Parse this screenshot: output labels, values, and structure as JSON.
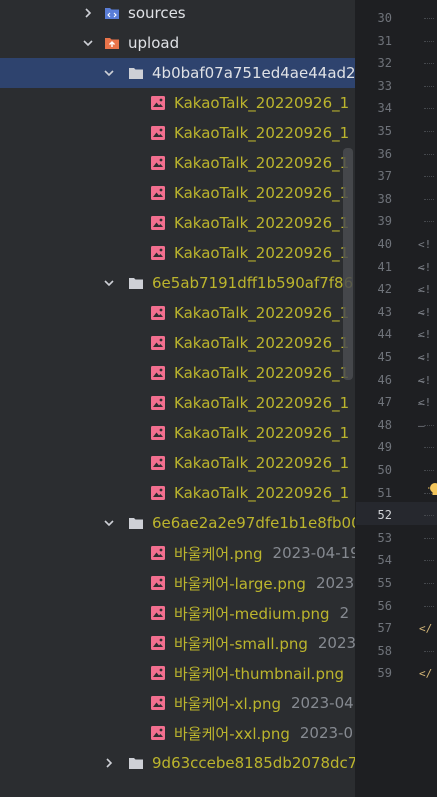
{
  "project_tree": {
    "rows": [
      {
        "kind": "folder-collapsed",
        "label": "sources",
        "style": "plain"
      },
      {
        "kind": "folder-expanded",
        "label": "upload",
        "style": "plain",
        "icon": "upload-folder"
      },
      {
        "kind": "folder-expanded",
        "label": "4b0baf07a751ed4ae44ad2",
        "style": "plain",
        "selected": true
      },
      {
        "kind": "file",
        "label": "KakaoTalk_20220926_1"
      },
      {
        "kind": "file",
        "label": "KakaoTalk_20220926_1"
      },
      {
        "kind": "file",
        "label": "KakaoTalk_20220926_1"
      },
      {
        "kind": "file",
        "label": "KakaoTalk_20220926_1"
      },
      {
        "kind": "file",
        "label": "KakaoTalk_20220926_1"
      },
      {
        "kind": "file",
        "label": "KakaoTalk_20220926_1"
      },
      {
        "kind": "folder-expanded",
        "label": "6e5ab7191dff1b590af7f86",
        "style": "mod"
      },
      {
        "kind": "file",
        "label": "KakaoTalk_20220926_1"
      },
      {
        "kind": "file",
        "label": "KakaoTalk_20220926_1"
      },
      {
        "kind": "file",
        "label": "KakaoTalk_20220926_1"
      },
      {
        "kind": "file",
        "label": "KakaoTalk_20220926_1"
      },
      {
        "kind": "file",
        "label": "KakaoTalk_20220926_1"
      },
      {
        "kind": "file",
        "label": "KakaoTalk_20220926_1"
      },
      {
        "kind": "file",
        "label": "KakaoTalk_20220926_1"
      },
      {
        "kind": "folder-expanded",
        "label": "6e6ae2a2e97dfe1b1e8fb00",
        "style": "mod"
      },
      {
        "kind": "file",
        "label": "바울케어.png",
        "meta": "2023-04-19"
      },
      {
        "kind": "file",
        "label": "바울케어-large.png",
        "meta": "2023"
      },
      {
        "kind": "file",
        "label": "바울케어-medium.png",
        "meta": "2"
      },
      {
        "kind": "file",
        "label": "바울케어-small.png",
        "meta": "2023"
      },
      {
        "kind": "file",
        "label": "바울케어-thumbnail.png",
        "meta": ""
      },
      {
        "kind": "file",
        "label": "바울케어-xl.png",
        "meta": "2023-04"
      },
      {
        "kind": "file",
        "label": "바울케어-xxl.png",
        "meta": "2023-0"
      },
      {
        "kind": "folder-collapsed",
        "label": "9d63ccebe8185db2078dc7",
        "style": "mod"
      }
    ]
  },
  "editor": {
    "first_line": 30,
    "last_line": 59,
    "current_line": 52,
    "snippets": [
      {
        "line": 40,
        "text": "<!—"
      },
      {
        "line": 41,
        "text": "<!—"
      },
      {
        "line": 42,
        "text": "<!—"
      },
      {
        "line": 43,
        "text": "<!—"
      },
      {
        "line": 44,
        "text": "<!—"
      },
      {
        "line": 45,
        "text": "<!—"
      },
      {
        "line": 46,
        "text": "<!—"
      },
      {
        "line": 47,
        "text": "<!—"
      },
      {
        "line": 57,
        "text": "</"
      },
      {
        "line": 59,
        "text": "</"
      }
    ]
  },
  "colors": {
    "tree_background": "#2b2d30",
    "selection": "#2e436e",
    "modified_text": "#bcb52d",
    "image_icon": "#f26f8f",
    "folder_icon": "#ced0d6",
    "upload_folder_icon": "#e9744a",
    "sources_folder_icon": "#5a7dd6",
    "editor_background": "#1e1f22"
  }
}
